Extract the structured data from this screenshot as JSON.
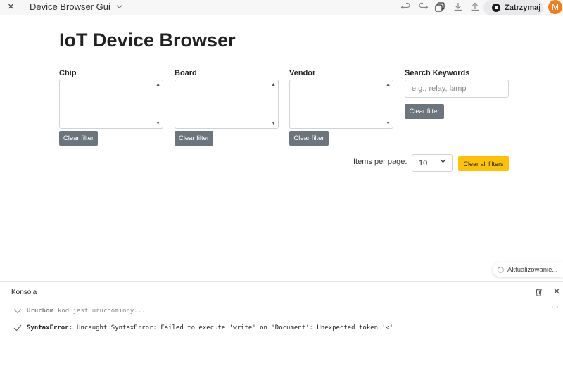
{
  "topbar": {
    "close_icon": "×",
    "app_title": "Device Browser Gui",
    "stop_label": "Zatrzymaj",
    "avatar_letter": "M",
    "avatar_color": "#f07d1a"
  },
  "main": {
    "title": "IoT Device Browser",
    "filters": [
      {
        "label": "Chip",
        "clear": "Clear filter"
      },
      {
        "label": "Board",
        "clear": "Clear filter"
      },
      {
        "label": "Vendor",
        "clear": "Clear filter"
      }
    ],
    "search": {
      "label": "Search Keywords",
      "placeholder": "e.g., relay, lamp",
      "clear": "Clear filter"
    },
    "items_per_page": {
      "label": "Items per page:",
      "value": "10"
    },
    "clear_all": "Clear all filters"
  },
  "toast": {
    "text": "Aktualizowanie..."
  },
  "console": {
    "title": "Konsola",
    "more": "···",
    "lines": [
      {
        "cmd": "Uruchom",
        "text": "kod jest uruchomiony..."
      },
      {
        "cmd": "SyntaxError:",
        "text": "Uncaught SyntaxError: Failed to execute 'write' on 'Document': Unexpected token '<'"
      }
    ]
  },
  "colors": {
    "accent_yellow": "#ffc107",
    "button_gray": "#6c757d"
  }
}
